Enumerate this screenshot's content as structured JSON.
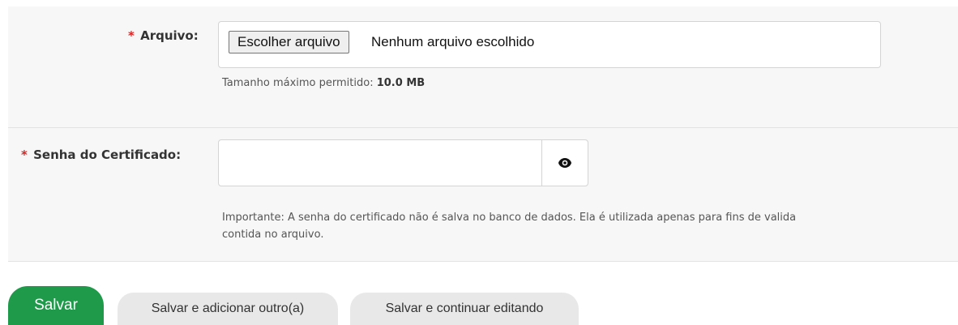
{
  "form": {
    "required_marker": "*",
    "file_field": {
      "label": "Arquivo:",
      "choose_button": "Escolher arquivo",
      "status": "Nenhum arquivo escolhido",
      "help_prefix": "Tamanho máximo permitido:",
      "help_value": "10.0 MB"
    },
    "password_field": {
      "label": "Senha do Certificado:",
      "value": "",
      "toggle_icon": "eye-icon",
      "help_line1": "Importante: A senha do certificado não é salva no banco de dados. Ela é utilizada apenas para fins de valida",
      "help_line2": "contida no arquivo."
    }
  },
  "actions": {
    "save": "Salvar",
    "save_add": "Salvar e adicionar outro(a)",
    "save_continue": "Salvar e continuar editando"
  },
  "colors": {
    "primary": "#1e9a4a",
    "required": "#dd2222",
    "fieldset_bg": "#f7f7f7"
  }
}
